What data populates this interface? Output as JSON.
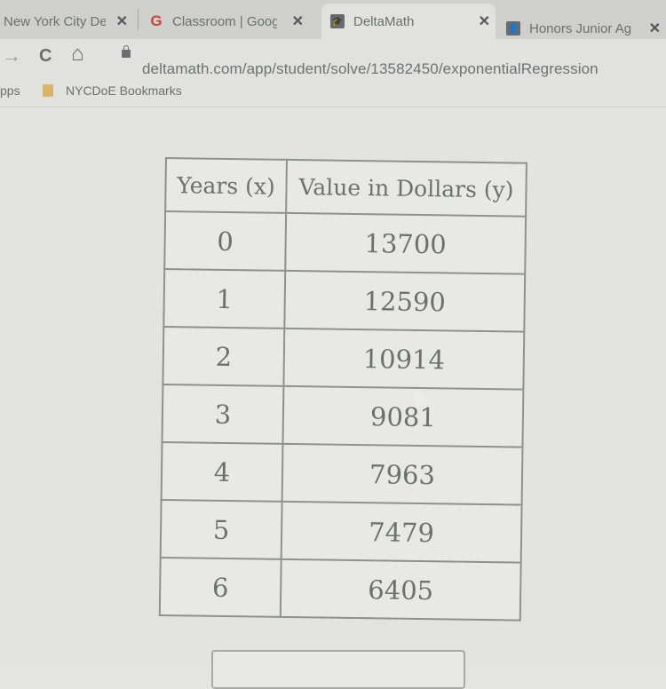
{
  "browser": {
    "tabs": [
      {
        "title": "New York City De",
        "icon": "nyc-doe-icon",
        "active": false
      },
      {
        "title": "Classroom | Goog",
        "icon": "google-g-icon",
        "active": false
      },
      {
        "title": "DeltaMath",
        "icon": "deltamath-icon",
        "active": true
      },
      {
        "title": "Honors Junior Ag",
        "icon": "classroom-icon",
        "active": false
      }
    ],
    "close_glyph": "✕",
    "nav": {
      "forward": "→",
      "reload": "C",
      "home": "⌂"
    },
    "url": "deltamath.com/app/student/solve/13582450/exponentialRegression",
    "bookmarks": [
      {
        "label": "pps"
      },
      {
        "label": "NYCDoE Bookmarks"
      }
    ]
  },
  "table": {
    "headers": [
      "Years (x)",
      "Value in Dollars (y)"
    ],
    "rows": [
      {
        "x": "0",
        "y": "13700"
      },
      {
        "x": "1",
        "y": "12590"
      },
      {
        "x": "2",
        "y": "10914"
      },
      {
        "x": "3",
        "y": "9081"
      },
      {
        "x": "4",
        "y": "7963"
      },
      {
        "x": "5",
        "y": "7479"
      },
      {
        "x": "6",
        "y": "6405"
      }
    ]
  },
  "answer_box": {
    "value": ""
  }
}
